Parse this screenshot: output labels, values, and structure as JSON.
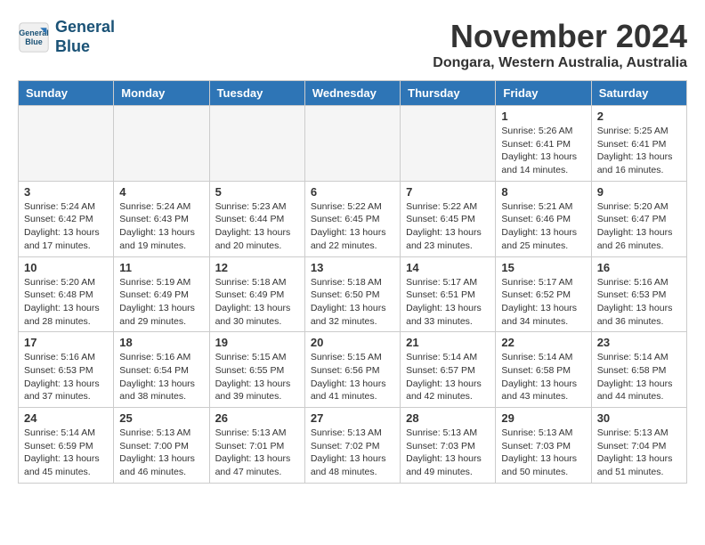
{
  "header": {
    "logo_line1": "General",
    "logo_line2": "Blue",
    "month": "November 2024",
    "location": "Dongara, Western Australia, Australia"
  },
  "weekdays": [
    "Sunday",
    "Monday",
    "Tuesday",
    "Wednesday",
    "Thursday",
    "Friday",
    "Saturday"
  ],
  "weeks": [
    [
      {
        "day": "",
        "info": ""
      },
      {
        "day": "",
        "info": ""
      },
      {
        "day": "",
        "info": ""
      },
      {
        "day": "",
        "info": ""
      },
      {
        "day": "",
        "info": ""
      },
      {
        "day": "1",
        "info": "Sunrise: 5:26 AM\nSunset: 6:41 PM\nDaylight: 13 hours\nand 14 minutes."
      },
      {
        "day": "2",
        "info": "Sunrise: 5:25 AM\nSunset: 6:41 PM\nDaylight: 13 hours\nand 16 minutes."
      }
    ],
    [
      {
        "day": "3",
        "info": "Sunrise: 5:24 AM\nSunset: 6:42 PM\nDaylight: 13 hours\nand 17 minutes."
      },
      {
        "day": "4",
        "info": "Sunrise: 5:24 AM\nSunset: 6:43 PM\nDaylight: 13 hours\nand 19 minutes."
      },
      {
        "day": "5",
        "info": "Sunrise: 5:23 AM\nSunset: 6:44 PM\nDaylight: 13 hours\nand 20 minutes."
      },
      {
        "day": "6",
        "info": "Sunrise: 5:22 AM\nSunset: 6:45 PM\nDaylight: 13 hours\nand 22 minutes."
      },
      {
        "day": "7",
        "info": "Sunrise: 5:22 AM\nSunset: 6:45 PM\nDaylight: 13 hours\nand 23 minutes."
      },
      {
        "day": "8",
        "info": "Sunrise: 5:21 AM\nSunset: 6:46 PM\nDaylight: 13 hours\nand 25 minutes."
      },
      {
        "day": "9",
        "info": "Sunrise: 5:20 AM\nSunset: 6:47 PM\nDaylight: 13 hours\nand 26 minutes."
      }
    ],
    [
      {
        "day": "10",
        "info": "Sunrise: 5:20 AM\nSunset: 6:48 PM\nDaylight: 13 hours\nand 28 minutes."
      },
      {
        "day": "11",
        "info": "Sunrise: 5:19 AM\nSunset: 6:49 PM\nDaylight: 13 hours\nand 29 minutes."
      },
      {
        "day": "12",
        "info": "Sunrise: 5:18 AM\nSunset: 6:49 PM\nDaylight: 13 hours\nand 30 minutes."
      },
      {
        "day": "13",
        "info": "Sunrise: 5:18 AM\nSunset: 6:50 PM\nDaylight: 13 hours\nand 32 minutes."
      },
      {
        "day": "14",
        "info": "Sunrise: 5:17 AM\nSunset: 6:51 PM\nDaylight: 13 hours\nand 33 minutes."
      },
      {
        "day": "15",
        "info": "Sunrise: 5:17 AM\nSunset: 6:52 PM\nDaylight: 13 hours\nand 34 minutes."
      },
      {
        "day": "16",
        "info": "Sunrise: 5:16 AM\nSunset: 6:53 PM\nDaylight: 13 hours\nand 36 minutes."
      }
    ],
    [
      {
        "day": "17",
        "info": "Sunrise: 5:16 AM\nSunset: 6:53 PM\nDaylight: 13 hours\nand 37 minutes."
      },
      {
        "day": "18",
        "info": "Sunrise: 5:16 AM\nSunset: 6:54 PM\nDaylight: 13 hours\nand 38 minutes."
      },
      {
        "day": "19",
        "info": "Sunrise: 5:15 AM\nSunset: 6:55 PM\nDaylight: 13 hours\nand 39 minutes."
      },
      {
        "day": "20",
        "info": "Sunrise: 5:15 AM\nSunset: 6:56 PM\nDaylight: 13 hours\nand 41 minutes."
      },
      {
        "day": "21",
        "info": "Sunrise: 5:14 AM\nSunset: 6:57 PM\nDaylight: 13 hours\nand 42 minutes."
      },
      {
        "day": "22",
        "info": "Sunrise: 5:14 AM\nSunset: 6:58 PM\nDaylight: 13 hours\nand 43 minutes."
      },
      {
        "day": "23",
        "info": "Sunrise: 5:14 AM\nSunset: 6:58 PM\nDaylight: 13 hours\nand 44 minutes."
      }
    ],
    [
      {
        "day": "24",
        "info": "Sunrise: 5:14 AM\nSunset: 6:59 PM\nDaylight: 13 hours\nand 45 minutes."
      },
      {
        "day": "25",
        "info": "Sunrise: 5:13 AM\nSunset: 7:00 PM\nDaylight: 13 hours\nand 46 minutes."
      },
      {
        "day": "26",
        "info": "Sunrise: 5:13 AM\nSunset: 7:01 PM\nDaylight: 13 hours\nand 47 minutes."
      },
      {
        "day": "27",
        "info": "Sunrise: 5:13 AM\nSunset: 7:02 PM\nDaylight: 13 hours\nand 48 minutes."
      },
      {
        "day": "28",
        "info": "Sunrise: 5:13 AM\nSunset: 7:03 PM\nDaylight: 13 hours\nand 49 minutes."
      },
      {
        "day": "29",
        "info": "Sunrise: 5:13 AM\nSunset: 7:03 PM\nDaylight: 13 hours\nand 50 minutes."
      },
      {
        "day": "30",
        "info": "Sunrise: 5:13 AM\nSunset: 7:04 PM\nDaylight: 13 hours\nand 51 minutes."
      }
    ]
  ]
}
